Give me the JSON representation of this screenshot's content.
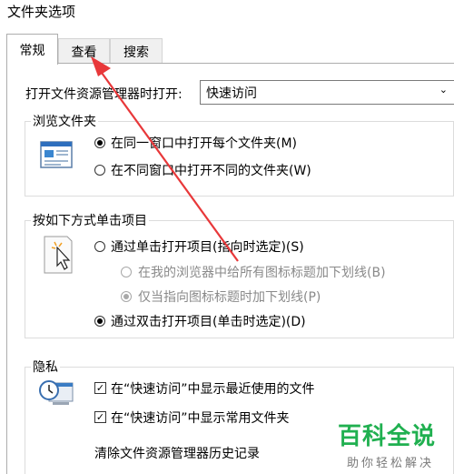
{
  "window": {
    "title": "文件夹选项"
  },
  "tabs": [
    {
      "label": "常规",
      "active": true
    },
    {
      "label": "查看",
      "active": false
    },
    {
      "label": "搜索",
      "active": false
    }
  ],
  "open_with": {
    "label": "打开文件资源管理器时打开:",
    "value": "快速访问"
  },
  "browse_folders": {
    "title": "浏览文件夹",
    "options": [
      {
        "label": "在同一窗口中打开每个文件夹(M)",
        "checked": true
      },
      {
        "label": "在不同窗口中打开不同的文件夹(W)",
        "checked": false
      }
    ]
  },
  "click_items": {
    "title": "按如下方式单击项目",
    "single_click": {
      "label": "通过单击打开项目(指向时选定)(S)",
      "checked": false
    },
    "underline_all": {
      "label": "在我的浏览器中给所有图标标题加下划线(B)",
      "checked": false,
      "disabled": true
    },
    "underline_point": {
      "label": "仅当指向图标标题时加下划线(P)",
      "checked": true,
      "disabled": true
    },
    "double_click": {
      "label": "通过双击打开项目(单击时选定)(D)",
      "checked": true
    }
  },
  "privacy": {
    "title": "隐私",
    "show_recent": {
      "label": "在“快速访问”中显示最近使用的文件",
      "checked": true
    },
    "show_frequent": {
      "label": "在“快速访问”中显示常用文件夹",
      "checked": true
    },
    "clear_history": {
      "label": "清除文件资源管理器历史记录"
    }
  },
  "watermark": {
    "main": "百科全说",
    "sub": "助你轻松解决"
  },
  "colors": {
    "annotation_arrow": "#e8383a",
    "watermark": "#20b050"
  }
}
